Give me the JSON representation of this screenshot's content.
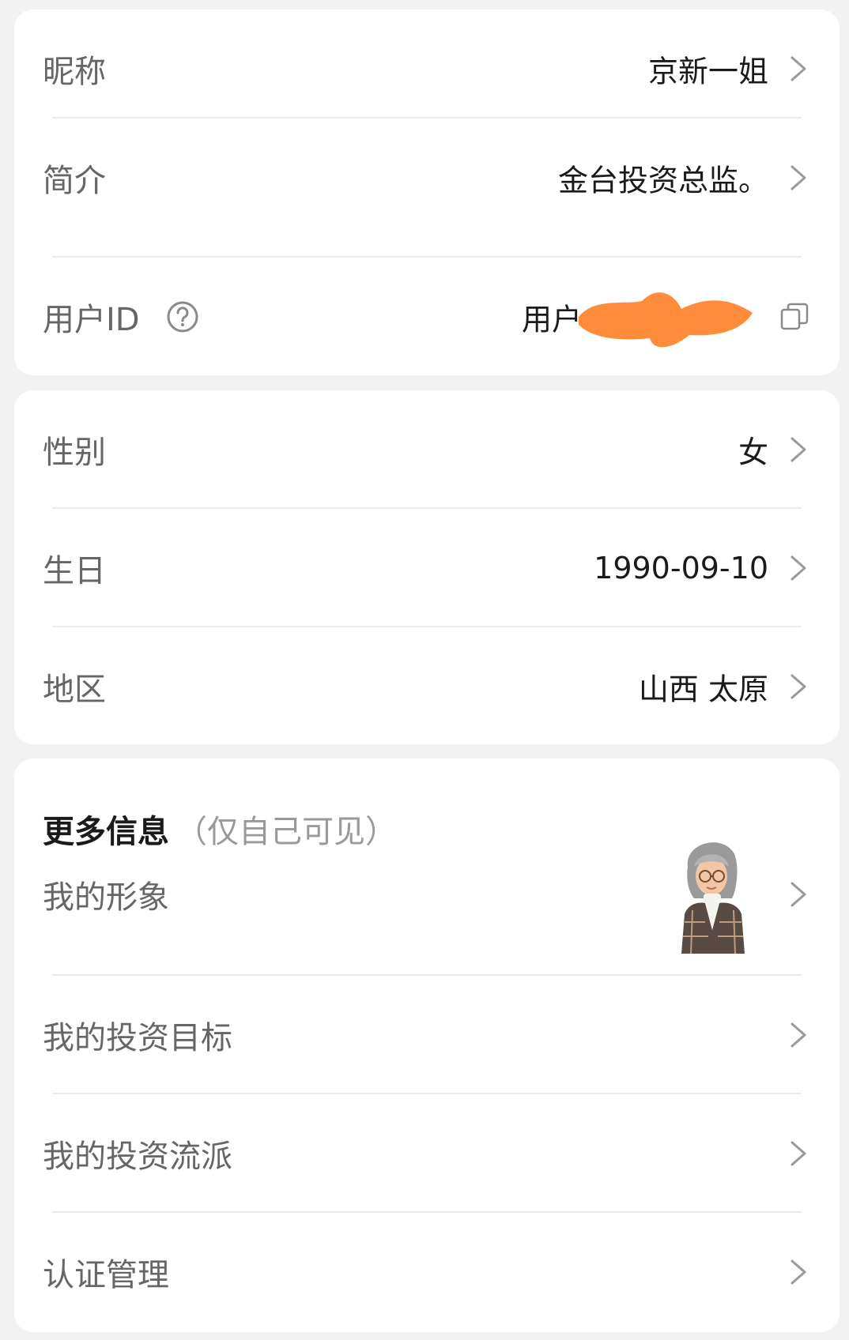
{
  "basic_info": {
    "nickname": {
      "label": "昵称",
      "value": "京新一姐"
    },
    "bio": {
      "label": "简介",
      "value": "金台投资总监。"
    },
    "user_id": {
      "label": "用户ID",
      "value": "用户"
    }
  },
  "personal_info": {
    "gender": {
      "label": "性别",
      "value": "女"
    },
    "birthday": {
      "label": "生日",
      "value": "1990-09-10"
    },
    "region": {
      "label": "地区",
      "value": "山西 太原"
    }
  },
  "more_info": {
    "title": "更多信息",
    "subtitle": "（仅自己可见）",
    "items": [
      {
        "label": "我的形象"
      },
      {
        "label": "我的投资目标"
      },
      {
        "label": "我的投资流派"
      },
      {
        "label": "认证管理"
      }
    ]
  },
  "colors": {
    "background": "#f2f2f2",
    "card": "#ffffff",
    "label": "#666666",
    "value": "#1a1a1a",
    "redaction": "#ff8c3a"
  }
}
